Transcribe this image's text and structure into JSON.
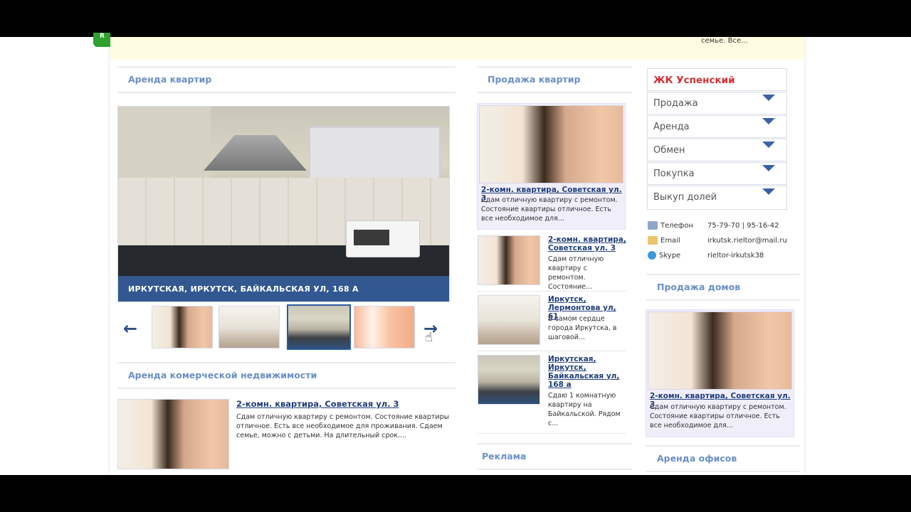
{
  "top_snippet": "семье. Все...",
  "green_tab_letter": "R",
  "sections": {
    "rent_apartments": "Аренда квартир",
    "sale_apartments": "Продажа квартир",
    "commercial_rent": "Аренда комерческой недвижимости",
    "ads": "Реклама",
    "sale_houses": "Продажа домов",
    "office_rent": "Аренда офисов"
  },
  "slider": {
    "caption": "ИРКУТСКАЯ, ИРКУТСК, БАЙКАЛЬСКАЯ УЛ, 168 А",
    "prev_label": "←",
    "next_label": "→"
  },
  "commercial_listing": {
    "title": "2-комн. квартира, Советская ул. 3",
    "text": "Сдам отличную квартиру с ремонтом. Состояние квартиры отличное. Есть все необходимое для проживания. Сдаем семье, можно с детьми. На длительный срок...."
  },
  "sale_featured": {
    "title": "2-комн. квартира, Советская ул. 3",
    "text": "Сдам отличную квартиру с ремонтом. Состояние квартиры отличное. Есть все необходимое для..."
  },
  "sale_items": [
    {
      "title": "2-комн. квартира, Советская ул. 3",
      "text": "Сдам отличную квартиру с ремонтом. Состояние..."
    },
    {
      "title": "Иркутск, Лермонтова ул, 61",
      "text": "В самом сердце города Иркутска, в шаговой..."
    },
    {
      "title": "Иркутская, Иркутск, Байкальская ул, 168 а",
      "text": "Сдаю 1 комнатную квартиру на Байкальской. Рядом с..."
    }
  ],
  "sidebar": {
    "title": "ЖК Успенский",
    "menu": [
      "Продажа",
      "Аренда",
      "Обмен",
      "Покупка",
      "Выкуп долей"
    ],
    "contacts": [
      {
        "label": "Телефон",
        "value": "75-79-70 | 95-16-42",
        "icon": "phone-icon"
      },
      {
        "label": "Email",
        "value": "irkutsk.rieltor@mail.ru",
        "icon": "email-icon"
      },
      {
        "label": "Skype",
        "value": "rieltor-irkutsk38",
        "icon": "skype-icon"
      }
    ]
  },
  "houses_featured": {
    "title": "2-комн. квартира, Советская ул. 3",
    "text": "Сдам отличную квартиру с ремонтом. Состояние квартиры отличное. Есть все необходимое для..."
  },
  "colors": {
    "section_heading": "#6a8fc8",
    "link": "#1f3e7a",
    "accent_red": "#d0302e",
    "caption_bar": "#325a96"
  }
}
